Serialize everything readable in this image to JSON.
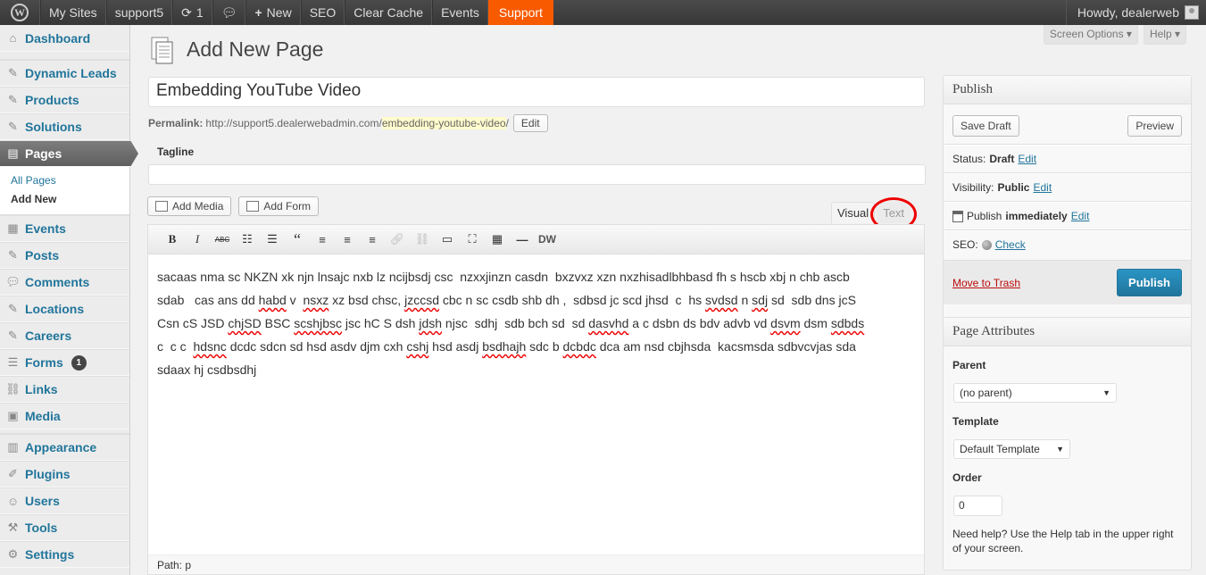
{
  "adminbar": {
    "wp_logo": "W",
    "my_sites": "My Sites",
    "site": "support5",
    "updates_count": "1",
    "new": "New",
    "seo": "SEO",
    "clear_cache": "Clear Cache",
    "events": "Events",
    "support": "Support",
    "howdy": "Howdy, dealerweb"
  },
  "menu": {
    "dashboard": "Dashboard",
    "dynamic_leads": "Dynamic Leads",
    "products": "Products",
    "solutions": "Solutions",
    "pages": "Pages",
    "all_pages": "All Pages",
    "add_new": "Add New",
    "events": "Events",
    "posts": "Posts",
    "comments": "Comments",
    "locations": "Locations",
    "careers": "Careers",
    "forms": "Forms",
    "forms_badge": "1",
    "links": "Links",
    "media": "Media",
    "appearance": "Appearance",
    "plugins": "Plugins",
    "users": "Users",
    "tools": "Tools",
    "settings": "Settings"
  },
  "screen_meta": {
    "screen_options": "Screen Options ▾",
    "help": "Help ▾"
  },
  "page": {
    "title": "Add New Page",
    "post_title": "Embedding YouTube Video",
    "permalink_label": "Permalink:",
    "permalink_base": "http://support5.dealerwebadmin.com/",
    "permalink_slug": "embedding-youtube-video",
    "permalink_end": "/",
    "edit": "Edit",
    "tagline_label": "Tagline",
    "tagline_value": ""
  },
  "editor": {
    "add_media": "Add Media",
    "add_form": "Add Form",
    "tab_visual": "Visual",
    "tab_text": "Text",
    "content": [
      [
        "sacaas nma sc NKZN xk njn lnsajc nxb lz ncijbsdj csc  nzxxjinzn casdn  bxzvxz xzn nxzhisadlbhbasd fh s hscb xbj n chb ascb"
      ],
      [
        "sdab   cas ans dd ",
        {
          "sq": "habd"
        },
        " v  ",
        {
          "sq": "nsxz"
        },
        " xz bsd chsc, ",
        {
          "sq": "jzccsd"
        },
        " cbc n sc csdb shb dh ,  sdbsd jc scd jhsd  c  hs ",
        {
          "sq": "svdsd"
        },
        " n ",
        {
          "sq": "sdj"
        },
        " sd  sdb dns jcS"
      ],
      [
        "Csn cS JSD ",
        {
          "sq": "chjSD"
        },
        " BSC ",
        {
          "sq": "scshjbsc"
        },
        " jsc hC S dsh ",
        {
          "sq": "jdsh"
        },
        " njsc  sdhj  sdb bch sd  sd ",
        {
          "sq": "dasvhd"
        },
        " a c dsbn ds bdv advb vd ",
        {
          "sq": "dsvm"
        },
        " dsm ",
        {
          "sq": "sdbds"
        }
      ],
      [
        "c  c c  ",
        {
          "sq": "hdsnc"
        },
        " dcdc sdcn sd hsd asdv djm cxh ",
        {
          "sq": "cshj"
        },
        " hsd asdj ",
        {
          "sq": "bsdhajh"
        },
        " sdc b ",
        {
          "sq": "dcbdc"
        },
        " dca am nsd cbjhsda  kacsmsda sdbvcvjas sda"
      ],
      [
        "sdaax hj csdbsdhj"
      ]
    ],
    "path": "Path: p"
  },
  "publish": {
    "heading": "Publish",
    "save_draft": "Save Draft",
    "preview": "Preview",
    "status_label": "Status:",
    "status_value": "Draft",
    "visibility_label": "Visibility:",
    "visibility_value": "Public",
    "publish_label": "Publish",
    "publish_value": "immediately",
    "seo_label": "SEO:",
    "check": "Check",
    "edit": "Edit",
    "move_to_trash": "Move to Trash",
    "publish_button": "Publish"
  },
  "attributes": {
    "heading": "Page Attributes",
    "parent_label": "Parent",
    "parent_value": "(no parent)",
    "template_label": "Template",
    "template_value": "Default Template",
    "order_label": "Order",
    "order_value": "0",
    "help_text": "Need help? Use the Help tab in the upper right of your screen."
  }
}
